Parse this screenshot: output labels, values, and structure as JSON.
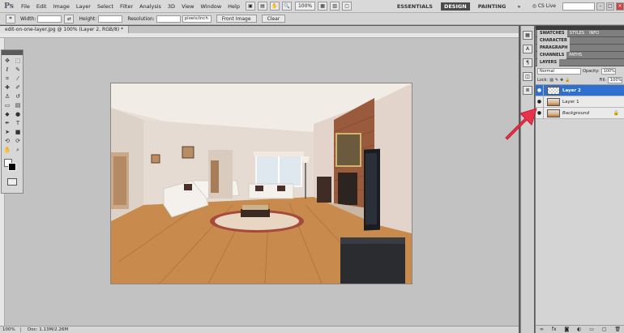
{
  "app": {
    "logo": "Ps",
    "menu": [
      "File",
      "Edit",
      "Image",
      "Layer",
      "Select",
      "Filter",
      "Analysis",
      "3D",
      "View",
      "Window",
      "Help"
    ],
    "zoom": "100%",
    "workspaces": [
      "ESSENTIALS",
      "DESIGN",
      "PAINTING"
    ],
    "active_workspace": "DESIGN",
    "cs_live": "CS Live"
  },
  "options": {
    "width_label": "Width:",
    "height_label": "Height:",
    "resolution_label": "Resolution:",
    "resolution_unit": "pixels/inch",
    "front_image": "Front Image",
    "clear": "Clear"
  },
  "document": {
    "tab_title": "edit-on-one-layer.jpg @ 100% (Layer 2, RGB/8) *"
  },
  "status": {
    "zoom": "100%",
    "doc_info": "Doc: 1.13M/2.26M"
  },
  "panels": {
    "group1": [
      "SWATCHES",
      "STYLES",
      "INFO"
    ],
    "group2": [
      "CHARACTER"
    ],
    "group3": [
      "PARAGRAPH"
    ],
    "group4": [
      "CHANNELS",
      "PATHS"
    ],
    "layers_tab": "LAYERS",
    "blend_mode": "Normal",
    "opacity_label": "Opacity:",
    "opacity_value": "100%",
    "lock_label": "Lock:",
    "fill_label": "Fill:",
    "fill_value": "100%",
    "layers": [
      {
        "name": "Layer 2",
        "selected": true
      },
      {
        "name": "Layer 1",
        "selected": false
      },
      {
        "name": "Background",
        "selected": false
      }
    ]
  },
  "colors": {
    "selection": "#2e6fd0",
    "arrow": "#e8344a"
  }
}
